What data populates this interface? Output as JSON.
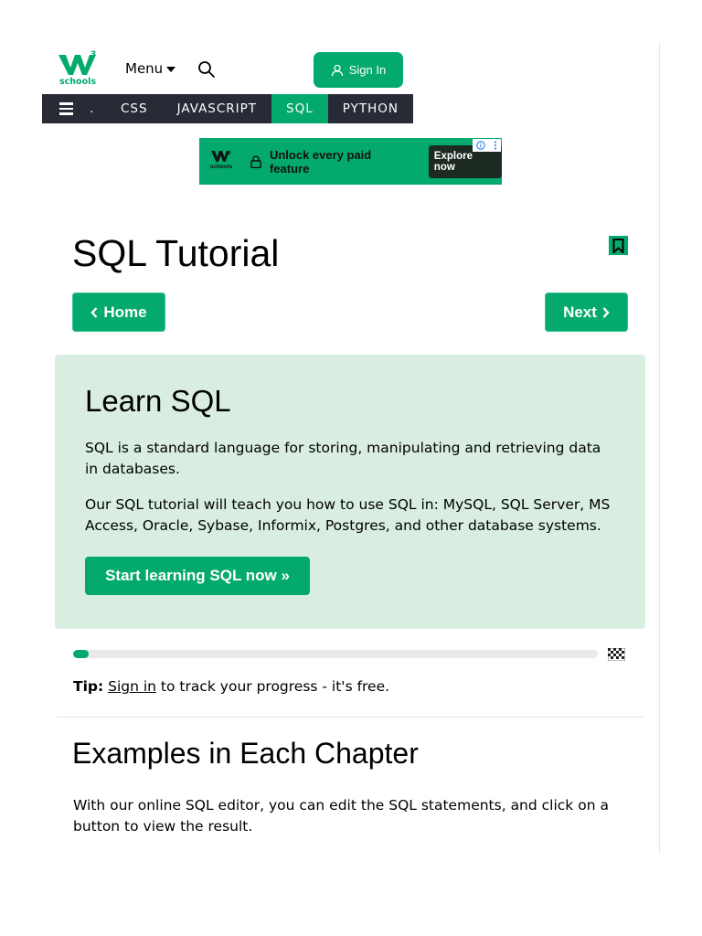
{
  "header": {
    "logo_superscript": "3",
    "logo_text": "schools",
    "menu_label": "Menu",
    "signin_label": "Sign In"
  },
  "topnav": {
    "dot": ".",
    "items": [
      {
        "label": "CSS",
        "active": false
      },
      {
        "label": "JAVASCRIPT",
        "active": false
      },
      {
        "label": "SQL",
        "active": true
      },
      {
        "label": "PYTHON",
        "active": false
      }
    ]
  },
  "ad": {
    "logo_superscript": "3",
    "logo_text": "schools",
    "text": "Unlock every paid feature",
    "cta": "Explore now"
  },
  "page": {
    "title": "SQL Tutorial",
    "home_label": "Home",
    "next_label": "Next"
  },
  "learn": {
    "title": "Learn SQL",
    "p1": "SQL is a standard language for storing, manipulating and retrieving data in databases.",
    "p2": "Our SQL tutorial will teach you how to use SQL in: MySQL, SQL Server, MS Access, Oracle, Sybase, Informix, Postgres, and other database systems.",
    "start_label": "Start learning SQL now »"
  },
  "progress": {
    "percent": 3
  },
  "tip": {
    "label": "Tip:",
    "link": "Sign in",
    "text": " to track your progress - it's free."
  },
  "examples": {
    "title": "Examples in Each Chapter",
    "p": "With our online SQL editor, you can edit the SQL statements, and click on a button to view the result."
  },
  "colors": {
    "brand": "#04aa6d",
    "nav_dark": "#282a35",
    "learn_bg": "#d9eee1"
  }
}
